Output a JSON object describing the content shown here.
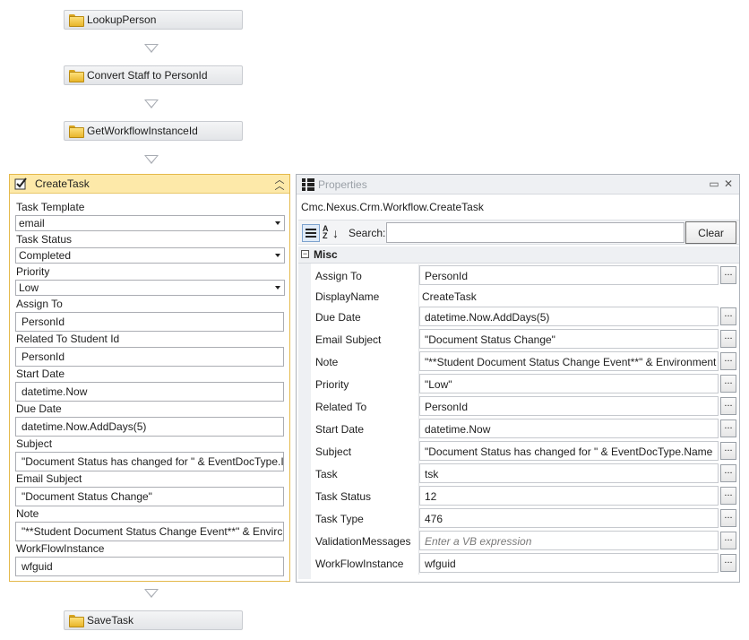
{
  "workflow": {
    "activities": [
      {
        "label": "LookupPerson",
        "icon": "folder-icon"
      },
      {
        "label": "Convert Staff to PersonId",
        "icon": "folder-icon"
      },
      {
        "label": "GetWorkflowInstanceId",
        "icon": "folder-icon"
      },
      {
        "label": "SaveTask",
        "icon": "folder-icon"
      }
    ]
  },
  "createtask": {
    "title": "CreateTask",
    "icon": "checklist-icon",
    "fields": [
      {
        "label": "Task Template",
        "value": "email",
        "kind": "select"
      },
      {
        "label": "Task Status",
        "value": "Completed",
        "kind": "select"
      },
      {
        "label": "Priority",
        "value": "Low",
        "kind": "select"
      },
      {
        "label": "Assign To",
        "value": "PersonId",
        "kind": "text"
      },
      {
        "label": "Related To Student Id",
        "value": "PersonId",
        "kind": "text"
      },
      {
        "label": "Start Date",
        "value": "datetime.Now",
        "kind": "text"
      },
      {
        "label": "Due Date",
        "value": "datetime.Now.AddDays(5)",
        "kind": "text"
      },
      {
        "label": "Subject",
        "value": "\"Document Status has changed for \" & EventDocType.I",
        "kind": "text"
      },
      {
        "label": "Email Subject",
        "value": "\"Document Status Change\"",
        "kind": "text"
      },
      {
        "label": "Note",
        "value": "\"**Student Document Status Change Event**\" & Envirc",
        "kind": "text"
      },
      {
        "label": "WorkFlowInstance",
        "value": "wfguid",
        "kind": "text"
      }
    ]
  },
  "properties": {
    "title": "Properties",
    "type_name": "Cmc.Nexus.Crm.Workflow.CreateTask",
    "search_label": "Search:",
    "search_value": "",
    "clear_label": "Clear",
    "category": "Misc",
    "rows": [
      {
        "name": "Assign To",
        "value": "PersonId",
        "editor": true
      },
      {
        "name": "DisplayName",
        "value": "CreateTask",
        "editor": false
      },
      {
        "name": "Due Date",
        "value": "datetime.Now.AddDays(5)",
        "editor": true
      },
      {
        "name": "Email Subject",
        "value": "\"Document Status Change\"",
        "editor": true
      },
      {
        "name": "Note",
        "value": "\"**Student Document Status Change Event**\" & Environment",
        "editor": true
      },
      {
        "name": "Priority",
        "value": "\"Low\"",
        "editor": true
      },
      {
        "name": "Related To",
        "value": "PersonId",
        "editor": true
      },
      {
        "name": "Start Date",
        "value": "datetime.Now",
        "editor": true
      },
      {
        "name": "Subject",
        "value": "\"Document Status has changed for \" & EventDocType.Name",
        "editor": true
      },
      {
        "name": "Task",
        "value": "tsk",
        "editor": true
      },
      {
        "name": "Task Status",
        "value": "12",
        "editor": true
      },
      {
        "name": "Task Type",
        "value": "476",
        "editor": true
      },
      {
        "name": "ValidationMessages",
        "value": "",
        "placeholder": "Enter a VB expression",
        "editor": true
      },
      {
        "name": "WorkFlowInstance",
        "value": "wfguid",
        "editor": true
      }
    ],
    "ellipsis": "..."
  }
}
